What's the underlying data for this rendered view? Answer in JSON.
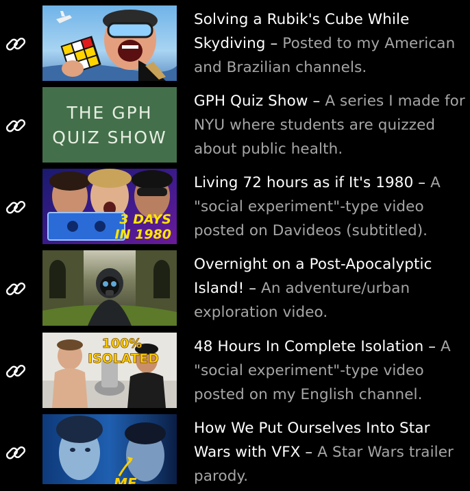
{
  "videos": [
    {
      "title": "Solving a Rubik's Cube While Skydiving",
      "separator": " – ",
      "description": "Posted to my American and Brazilian channels.",
      "link_icon": "link-icon",
      "thumbnail": "skydiving-rubiks-cube-thumbnail"
    },
    {
      "title": "GPH Quiz Show",
      "separator": " – ",
      "description": "A series I made for NYU where students are quizzed about public health.",
      "link_icon": "link-icon",
      "thumbnail": "gph-quiz-show-thumbnail",
      "thumb_text_1": "THE GPH",
      "thumb_text_2": "QUIZ SHOW"
    },
    {
      "title": "Living 72 hours as if It's 1980",
      "separator": " – ",
      "description": "A \"social experiment\"-type video posted on Davideos (subtitled).",
      "link_icon": "link-icon",
      "thumbnail": "living-1980-thumbnail",
      "thumb_text_1": "3 DAYS",
      "thumb_text_2": "IN 1980"
    },
    {
      "title": "Overnight on a Post-Apocalyptic Island!",
      "separator": " – ",
      "description": "An adventure/urban exploration video.",
      "link_icon": "link-icon",
      "thumbnail": "post-apocalyptic-island-thumbnail"
    },
    {
      "title": "48 Hours In Complete Isolation",
      "separator": " – ",
      "description": "A \"social experiment\"-type video posted on my English channel.",
      "link_icon": "link-icon",
      "thumbnail": "isolation-thumbnail",
      "thumb_text_1": "100%",
      "thumb_text_2": "ISOLATED"
    },
    {
      "title": "How We Put Ourselves Into Star Wars with VFX",
      "separator": " – ",
      "description": "A Star Wars trailer parody.",
      "link_icon": "link-icon",
      "thumbnail": "star-wars-vfx-thumbnail",
      "thumb_text_1": "ME"
    }
  ],
  "colors": {
    "background": "#000000",
    "title": "#ffffff",
    "description": "#a6a6a6"
  }
}
